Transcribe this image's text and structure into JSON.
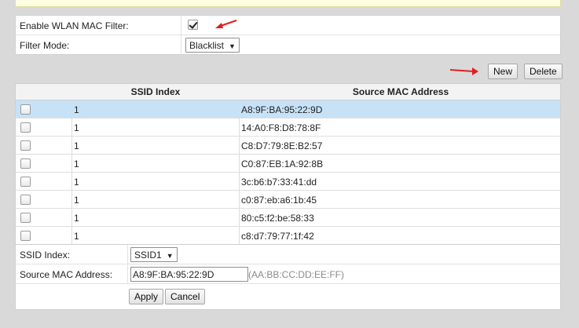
{
  "settings": {
    "enable_label": "Enable WLAN MAC Filter:",
    "enable_checked": true,
    "filter_mode_label": "Filter Mode:",
    "filter_mode_value": "Blacklist"
  },
  "toolbar": {
    "new_label": "New",
    "delete_label": "Delete"
  },
  "table": {
    "headers": {
      "ssid": "SSID Index",
      "mac": "Source MAC Address"
    },
    "rows": [
      {
        "ssid": "1",
        "mac": "A8:9F:BA:95:22:9D",
        "selected": true
      },
      {
        "ssid": "1",
        "mac": "14:A0:F8:D8:78:8F"
      },
      {
        "ssid": "1",
        "mac": "C8:D7:79:8E:B2:57"
      },
      {
        "ssid": "1",
        "mac": "C0:87:EB:1A:92:8B"
      },
      {
        "ssid": "1",
        "mac": "3c:b6:b7:33:41:dd"
      },
      {
        "ssid": "1",
        "mac": "c0:87:eb:a6:1b:45"
      },
      {
        "ssid": "1",
        "mac": "80:c5:f2:be:58:33"
      },
      {
        "ssid": "1",
        "mac": "c8:d7:79:77:1f:42"
      }
    ]
  },
  "form": {
    "ssid_label": "SSID Index:",
    "ssid_value": "SSID1",
    "mac_label": "Source MAC Address:",
    "mac_value": "A8:9F:BA:95:22:9D",
    "mac_hint": "(AA:BB:CC:DD:EE:FF)",
    "apply_label": "Apply",
    "cancel_label": "Cancel"
  },
  "colors": {
    "selected_row": "#c7e2f7",
    "annotation_arrow": "#e02020"
  },
  "icons": {
    "dropdown": "chevron-down-icon",
    "annotation": "red-arrow-icon"
  }
}
